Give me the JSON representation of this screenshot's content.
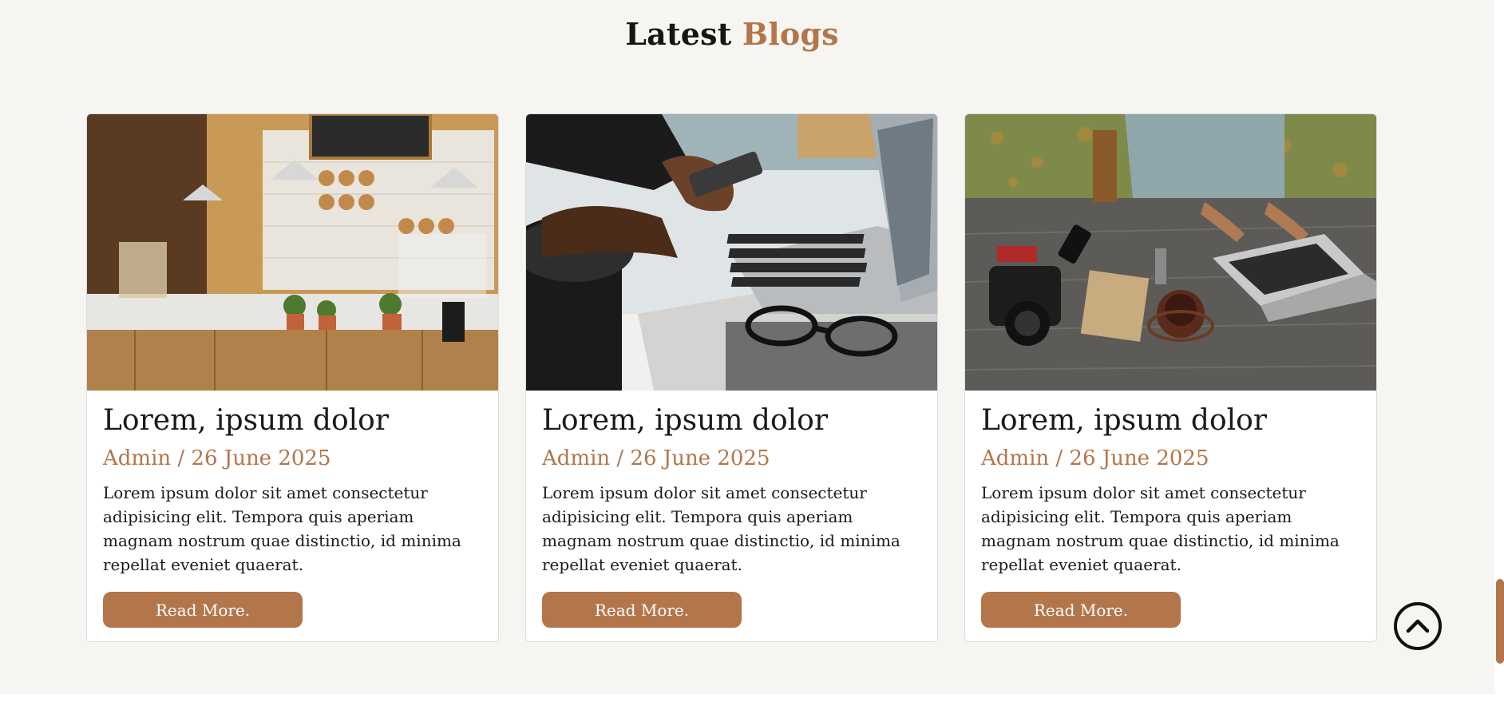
{
  "section": {
    "title_main": "Latest",
    "title_accent": "Blogs"
  },
  "colors": {
    "accent": "#b3764b",
    "background": "#f6f5f2",
    "text": "#1a1a1a"
  },
  "posts": [
    {
      "image": "cafe-bakery-photo",
      "title": "Lorem, ipsum dolor",
      "meta": "Admin / 26 June 2025",
      "excerpt": "Lorem ipsum dolor sit amet consectetur adipisicing elit. Tempora quis aperiam magnam nostrum quae distinctio, id minima repellat eveniet quaerat.",
      "button": "Read More."
    },
    {
      "image": "laptop-phone-photo",
      "title": "Lorem, ipsum dolor",
      "meta": "Admin / 26 June 2025",
      "excerpt": "Lorem ipsum dolor sit amet consectetur adipisicing elit. Tempora quis aperiam magnam nostrum quae distinctio, id minima repellat eveniet quaerat.",
      "button": "Read More."
    },
    {
      "image": "desk-camera-laptop-photo",
      "title": "Lorem, ipsum dolor",
      "meta": "Admin / 26 June 2025",
      "excerpt": "Lorem ipsum dolor sit amet consectetur adipisicing elit. Tempora quis aperiam magnam nostrum quae distinctio, id minima repellat eveniet quaerat.",
      "button": "Read More."
    }
  ],
  "scroll_top": {
    "icon": "chevron-up-icon"
  }
}
